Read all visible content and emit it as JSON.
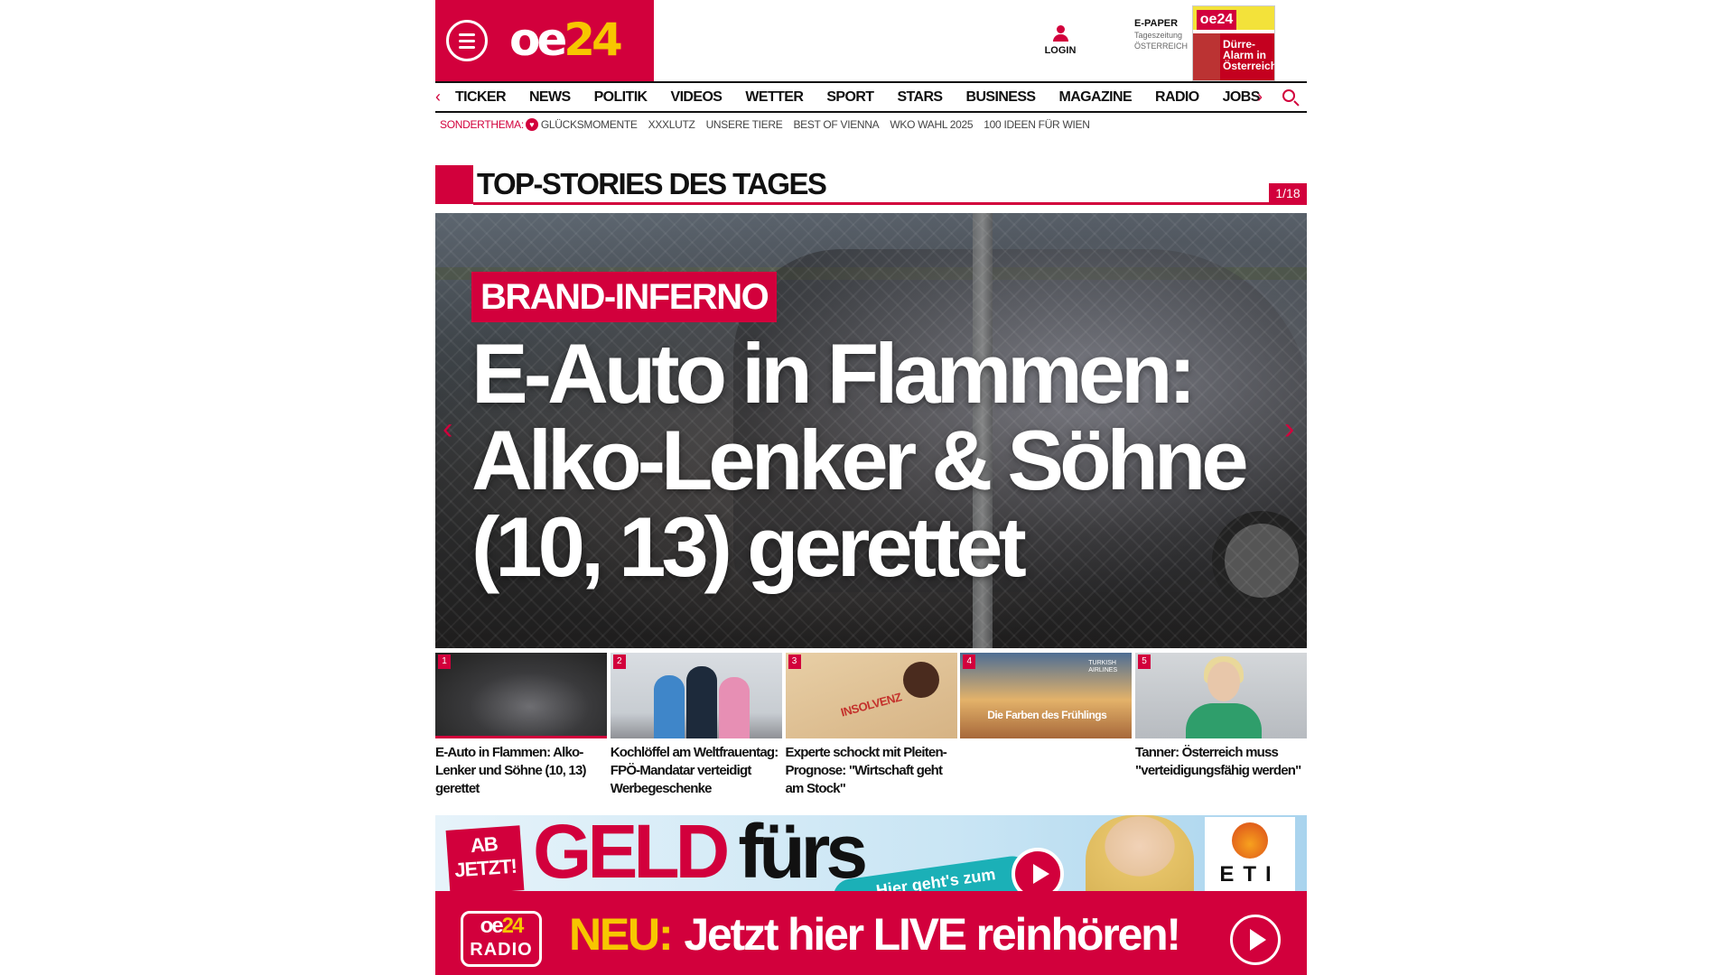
{
  "header": {
    "logo_oe": "oe",
    "logo_24": "24",
    "login_label": "LOGIN",
    "epaper_title": "E-PAPER",
    "epaper_sub1": "Tageszeitung",
    "epaper_sub2": "ÖSTERREICH",
    "epaper_cover_logo": "oe24",
    "epaper_cover_headline": "Dürre-Alarm in Österreich"
  },
  "nav": {
    "prev_arrow": "‹",
    "next_arrow": "›",
    "items": [
      "TICKER",
      "NEWS",
      "POLITIK",
      "VIDEOS",
      "WETTER",
      "SPORT",
      "STARS",
      "BUSINESS",
      "MAGAZINE",
      "RADIO",
      "JOBS"
    ]
  },
  "subnav": {
    "label": "SONDERTHEMA:",
    "items": [
      "GLÜCKSMOMENTE",
      "XXXLUTZ",
      "UNSERE TIERE",
      "BEST OF VIENNA",
      "WKO WAHL 2025",
      "100 IDEEN FÜR WIEN"
    ]
  },
  "section": {
    "title": "TOP-STORIES DES TAGES",
    "counter": "1/18"
  },
  "hero": {
    "kicker": "BRAND-INFERNO",
    "title": "E-Auto in Flammen: Alko-Lenker & Söhne (10, 13) gerettet",
    "prev_arrow": "‹",
    "next_arrow": "›"
  },
  "thumbs": [
    {
      "num": "1",
      "title": "E-Auto in Flammen: Alko-Lenker und Söhne (10, 13) gerettet"
    },
    {
      "num": "2",
      "title": "Kochlöffel am Weltfrauentag: FPÖ-Mandatar verteidigt Werbegeschenke"
    },
    {
      "num": "3",
      "title": "Experte schockt mit Pleiten-Prognose: \"Wirtschaft geht am Stock\"",
      "image_text": "INSOLVENZ"
    },
    {
      "num": "4",
      "title": "",
      "image_text": "Die Farben des Frühlings",
      "image_brand": "TURKISH AIRLINES"
    },
    {
      "num": "5",
      "title": "Tanner: Österreich muss \"verteidigungsfähig werden\""
    }
  ],
  "ad": {
    "badge": "AB JETZT!",
    "headline_1": "GELD",
    "headline_2": "fürs",
    "cta": "Hier geht's zum",
    "brand": "ETI"
  },
  "radio": {
    "logo_oe": "oe",
    "logo_24": "24",
    "logo_label": "RADIO",
    "new_label": "NEU:",
    "text": "Jetzt hier LIVE reinhören!"
  }
}
